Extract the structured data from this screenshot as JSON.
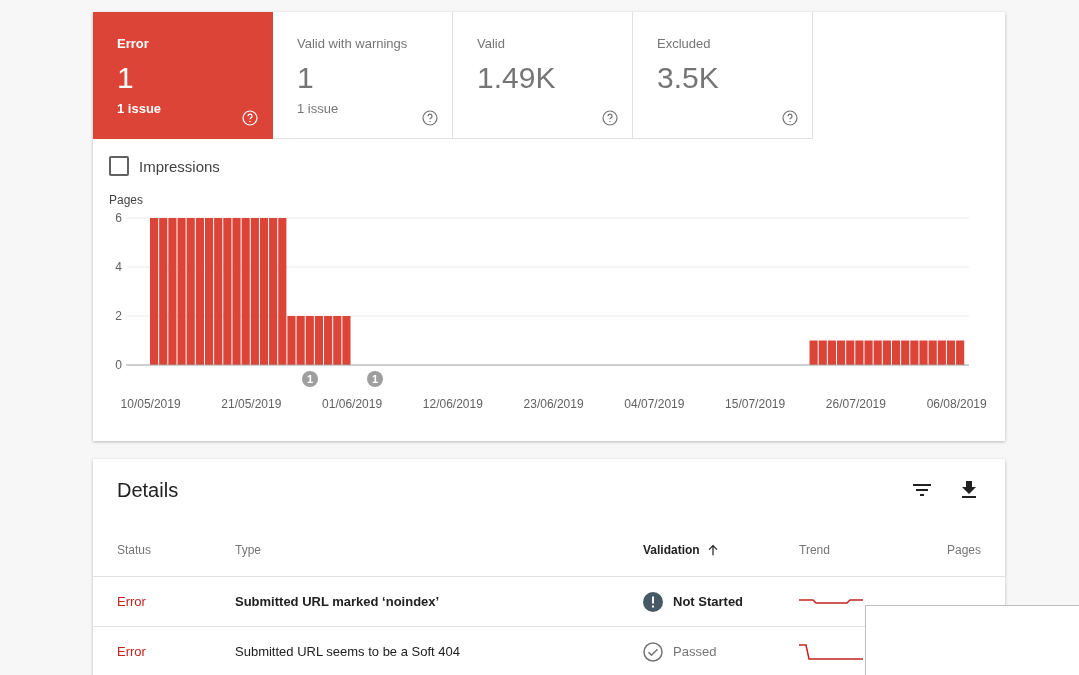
{
  "summary_tiles": [
    {
      "label": "Error",
      "value": "1",
      "sub": "1 issue",
      "selected": true
    },
    {
      "label": "Valid with warnings",
      "value": "1",
      "sub": "1 issue",
      "selected": false
    },
    {
      "label": "Valid",
      "value": "1.49K",
      "selected": false
    },
    {
      "label": "Excluded",
      "value": "3.5K",
      "selected": false
    }
  ],
  "impressions": {
    "label": "Impressions",
    "checked": false
  },
  "chart": {
    "chart_data": {
      "type": "bar",
      "ylabel": "Pages",
      "categories": [
        "10/05/2019",
        null,
        null,
        null,
        null,
        null,
        null,
        null,
        null,
        null,
        null,
        "21/05/2019",
        null,
        null,
        null,
        null,
        null,
        null,
        null,
        null,
        null,
        null,
        "01/06/2019",
        null,
        null,
        null,
        null,
        null,
        null,
        null,
        null,
        null,
        null,
        "12/06/2019",
        null,
        null,
        null,
        null,
        null,
        null,
        null,
        null,
        null,
        null,
        "23/06/2019",
        null,
        null,
        null,
        null,
        null,
        null,
        null,
        null,
        null,
        null,
        "04/07/2019",
        null,
        null,
        null,
        null,
        null,
        null,
        null,
        null,
        null,
        null,
        "15/07/2019",
        null,
        null,
        null,
        null,
        null,
        null,
        null,
        null,
        null,
        null,
        "26/07/2019",
        null,
        null,
        null,
        null,
        null,
        null,
        null,
        null,
        null,
        null,
        "06/08/2019"
      ],
      "series": [
        {
          "color": "#db4437",
          "values": [
            6,
            6,
            6,
            6,
            6,
            6,
            6,
            6,
            6,
            6,
            6,
            6,
            6,
            6,
            6,
            2,
            2,
            2,
            2,
            2,
            2,
            2,
            0,
            0,
            0,
            0,
            0,
            0,
            0,
            0,
            0,
            0,
            0,
            0,
            0,
            0,
            0,
            0,
            0,
            0,
            0,
            0,
            0,
            0,
            0,
            0,
            0,
            0,
            0,
            0,
            0,
            0,
            0,
            0,
            0,
            0,
            0,
            0,
            0,
            0,
            0,
            0,
            0,
            0,
            0,
            0,
            0,
            0,
            0,
            0,
            0,
            0,
            1,
            1,
            1,
            1,
            1,
            1,
            1,
            1,
            1,
            1,
            1,
            1,
            1,
            1,
            1,
            1,
            1
          ]
        }
      ],
      "ylim": [
        0,
        6
      ],
      "yticks": [
        0,
        2,
        4,
        6
      ],
      "annotations": [
        "1",
        "1"
      ]
    }
  },
  "details": {
    "title": "Details",
    "columns": [
      {
        "label": "Status",
        "sorted": false
      },
      {
        "label": "Type",
        "sorted": false
      },
      {
        "label": "Validation",
        "sorted": true
      },
      {
        "label": "Trend",
        "sorted": false
      },
      {
        "label": "Pages",
        "sorted": false
      }
    ],
    "rows": [
      {
        "status": "Error",
        "type": "Submitted URL marked ‘noindex’",
        "validation": {
          "kind": "not_started",
          "label": "Not Started"
        },
        "trend": {
          "kind": "dip"
        }
      },
      {
        "status": "Error",
        "type": "Submitted URL seems to be a Soft 404",
        "validation": {
          "kind": "passed",
          "label": "Passed"
        },
        "trend": {
          "kind": "drop"
        }
      }
    ]
  }
}
